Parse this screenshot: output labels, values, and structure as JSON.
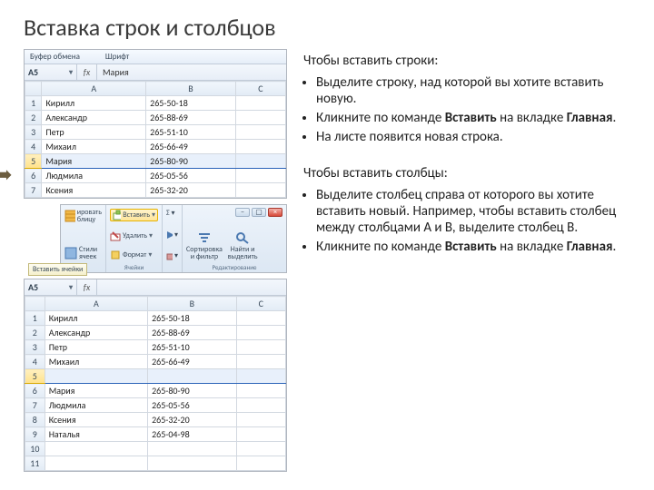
{
  "title": "Вставка строк и столбцов",
  "ribbon_groups": {
    "clipboard": "Буфер обмена",
    "font": "Шрифт"
  },
  "sheet1": {
    "namebox": "A5",
    "formula": "Мария",
    "cols": [
      "A",
      "B",
      "C"
    ],
    "rows": [
      {
        "n": "1",
        "a": "Кирилл",
        "b": "265-50-18"
      },
      {
        "n": "2",
        "a": "Александр",
        "b": "265-88-69"
      },
      {
        "n": "3",
        "a": "Петр",
        "b": "265-51-10"
      },
      {
        "n": "4",
        "a": "Михаил",
        "b": "265-66-49"
      },
      {
        "n": "5",
        "a": "Мария",
        "b": "265-80-90",
        "sel": true
      },
      {
        "n": "6",
        "a": "Людмила",
        "b": "265-05-56"
      },
      {
        "n": "7",
        "a": "Ксения",
        "b": "265-32-20"
      }
    ]
  },
  "ribbon_mid": {
    "styles": "Стили\nячеек",
    "format_table": "ировать\nблицу",
    "insert": "Вставить",
    "delete": "Удалить",
    "format": "Формат",
    "cells_group": "Ячейки",
    "sort": "Сортировка\nи фильтр",
    "find": "Найти и\nвыделить",
    "edit_group": "Редактирование",
    "tooltip": "Вставить ячейки"
  },
  "sheet2": {
    "namebox": "A5",
    "formula": "",
    "cols": [
      "A",
      "B",
      "C"
    ],
    "rows": [
      {
        "n": "1",
        "a": "Кирилл",
        "b": "265-50-18"
      },
      {
        "n": "2",
        "a": "Александр",
        "b": "265-88-69"
      },
      {
        "n": "3",
        "a": "Петр",
        "b": "265-51-10"
      },
      {
        "n": "4",
        "a": "Михаил",
        "b": "265-66-49"
      },
      {
        "n": "5",
        "a": "",
        "b": "",
        "sel": true
      },
      {
        "n": "6",
        "a": "Мария",
        "b": "265-80-90"
      },
      {
        "n": "7",
        "a": "Людмила",
        "b": "265-05-56"
      },
      {
        "n": "8",
        "a": "Ксения",
        "b": "265-32-20"
      },
      {
        "n": "9",
        "a": "Наталья",
        "b": "265-04-98"
      },
      {
        "n": "10",
        "a": "",
        "b": ""
      },
      {
        "n": "11",
        "a": "",
        "b": ""
      }
    ]
  },
  "text": {
    "rows_heading": "Чтобы вставить строки:",
    "rows_b1": "Выделите строку, над которой вы хотите вставить новую.",
    "rows_b2a": "Кликните по команде ",
    "rows_b2b": "Вставить",
    "rows_b2c": " на вкладке ",
    "rows_b2d": "Главная",
    "rows_b2e": ".",
    "rows_b3": "На листе появится новая строка.",
    "cols_heading": "Чтобы вставить столбцы:",
    "cols_b1": "Выделите столбец справа от которого вы хотите вставить новый. Например, чтобы вставить столбец между столбцами A и B, выделите столбец B.",
    "cols_b2a": "Кликните по команде ",
    "cols_b2b": "Вставить",
    "cols_b2c": " на вкладке ",
    "cols_b2d": "Главная",
    "cols_b2e": "."
  }
}
